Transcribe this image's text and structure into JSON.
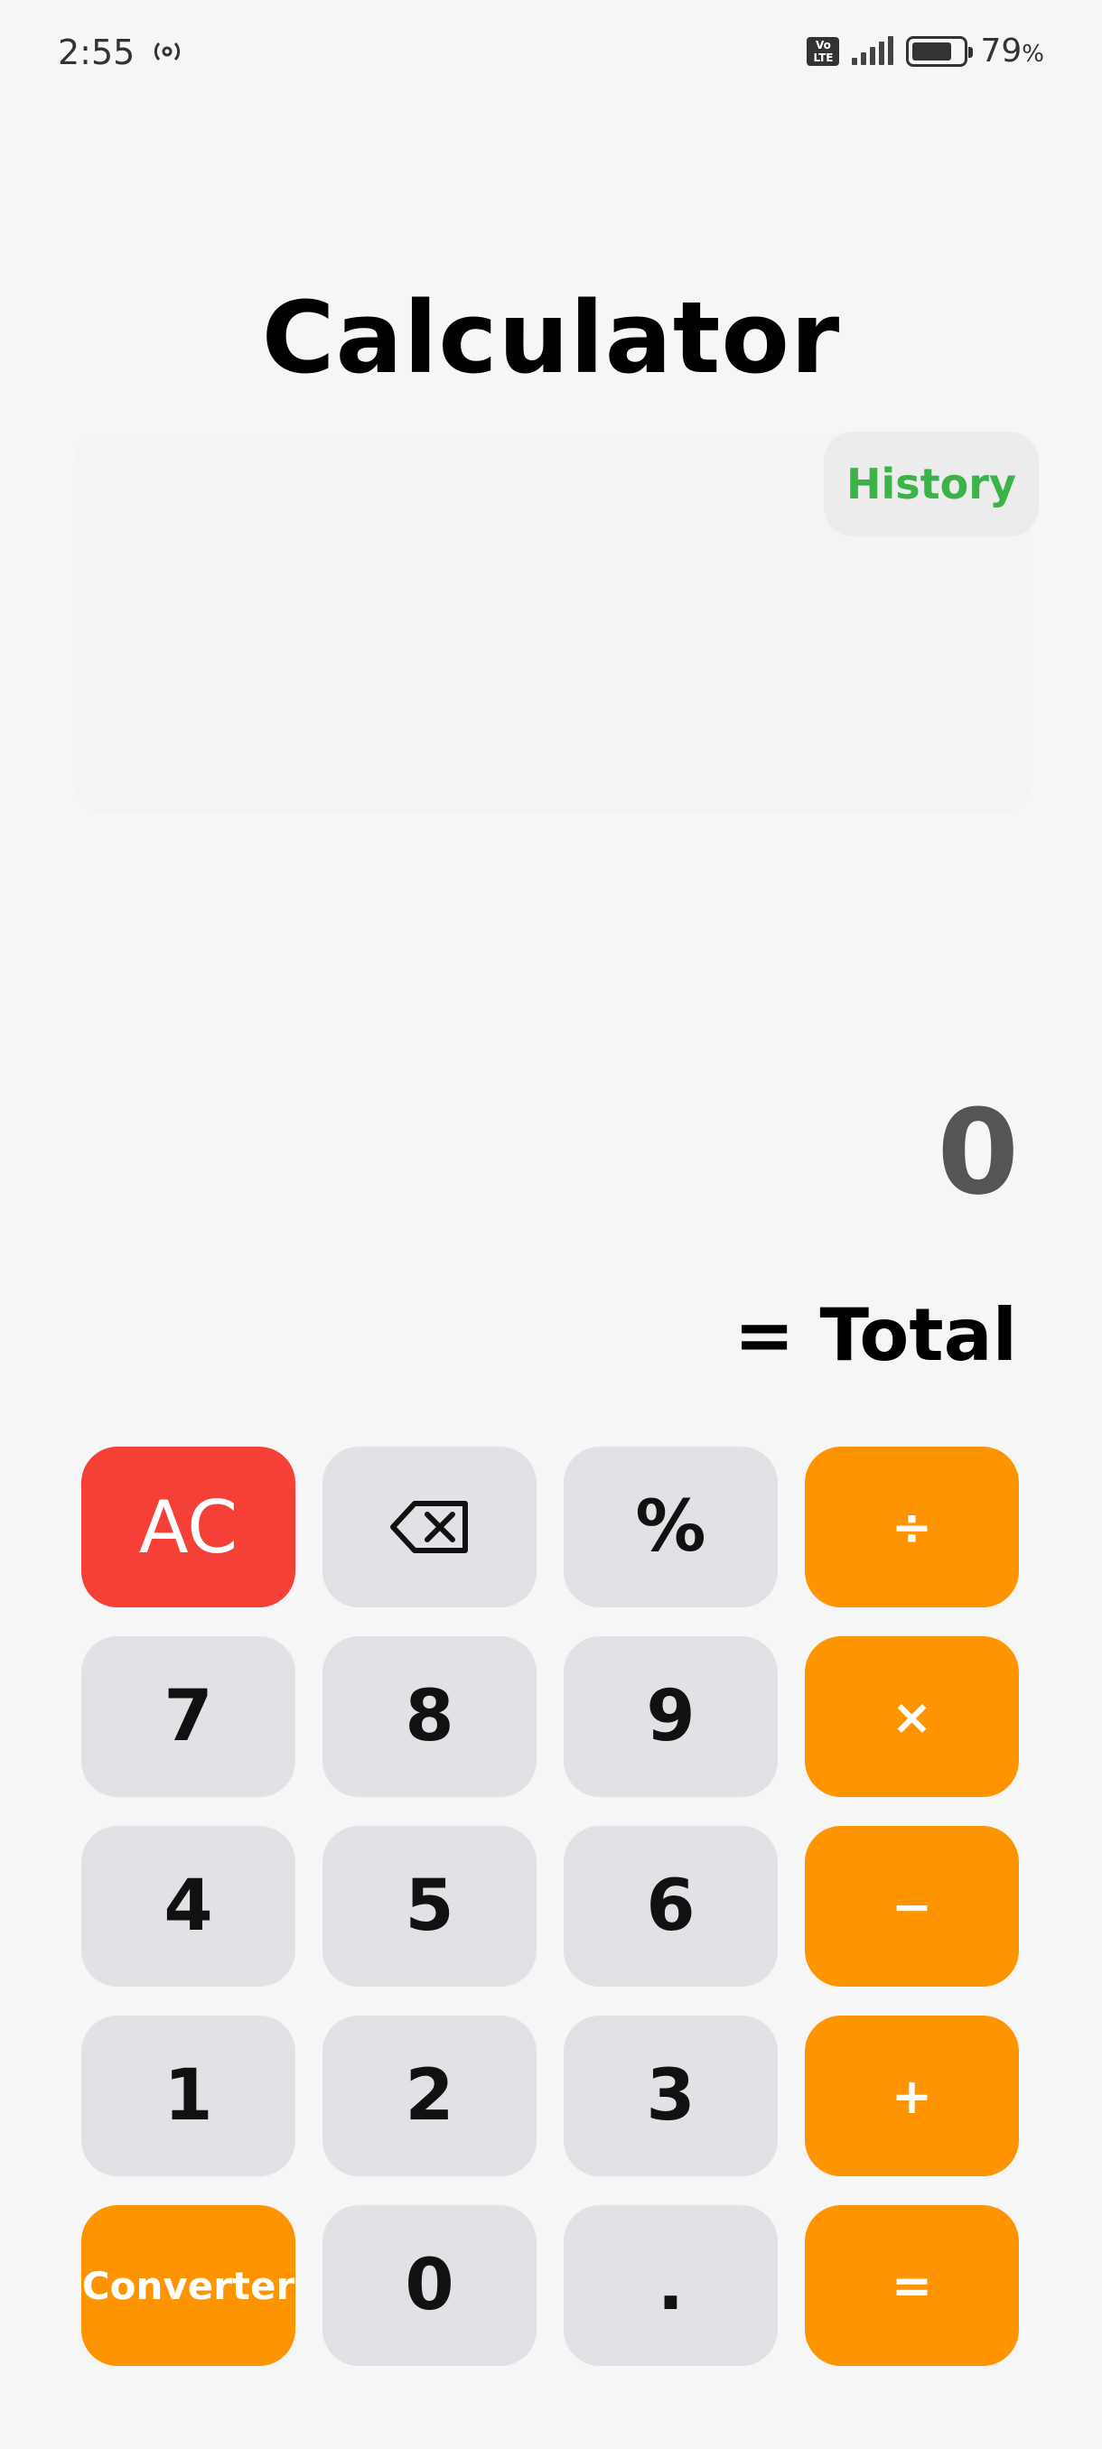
{
  "status_bar": {
    "time": "2:55",
    "network_badge": "Vo LTE",
    "battery_percent": "79",
    "battery_unit": "%",
    "battery_level": 0.79,
    "icons": [
      "hotspot-icon",
      "volte-icon",
      "signal-icon",
      "battery-icon"
    ]
  },
  "app": {
    "title": "Calculator",
    "history_label": "History",
    "history_color": "#3bb24a"
  },
  "display": {
    "value": "0",
    "total_label": "= Total"
  },
  "keypad": {
    "rows": [
      [
        "AC",
        "⌫",
        "%",
        "÷"
      ],
      [
        "7",
        "8",
        "9",
        "×"
      ],
      [
        "4",
        "5",
        "6",
        "−"
      ],
      [
        "1",
        "2",
        "3",
        "+"
      ],
      [
        "Converter",
        "0",
        ".",
        "="
      ]
    ],
    "colors": {
      "operator": "#fe9500",
      "clear": "#f54038",
      "digit": "#e1e2e6"
    }
  }
}
